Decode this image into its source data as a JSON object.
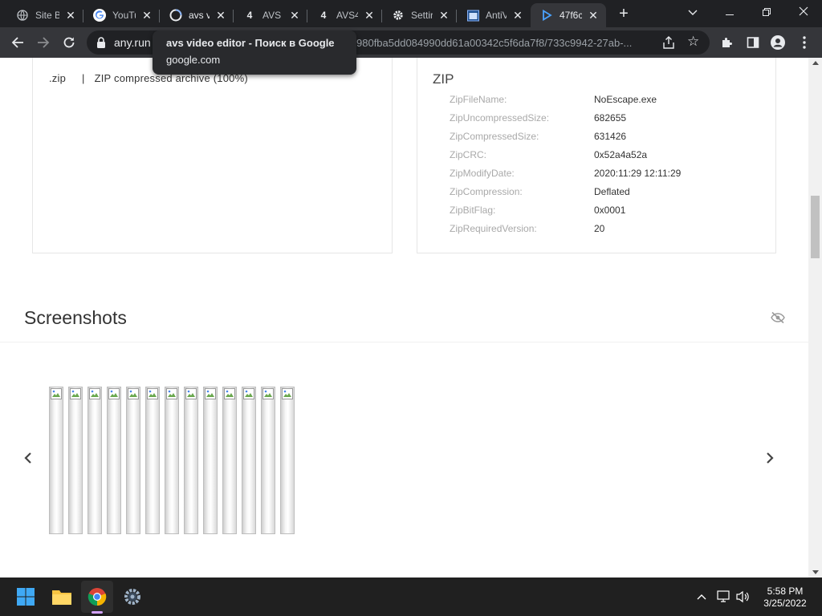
{
  "browser": {
    "tabs": [
      {
        "title": "Site B",
        "icon": "globe-icon"
      },
      {
        "title": "YouTu",
        "icon": "google-g-icon"
      },
      {
        "title": "avs vi",
        "icon": "loading-icon"
      },
      {
        "title": "AVS V",
        "icon": "number-4-icon",
        "badge": "4"
      },
      {
        "title": "AVS4",
        "icon": "number-4-icon",
        "badge": "4"
      },
      {
        "title": "Settir",
        "icon": "gear-icon"
      },
      {
        "title": "AntiV",
        "icon": "window-icon"
      },
      {
        "title": "47f6c",
        "icon": "anyrun-play-icon"
      }
    ],
    "active_tab_index": 7,
    "address": {
      "host": "any.run",
      "path": "980fba5dd084990dd61a00342c5f6da7f8/733c9942-27ab-..."
    },
    "tooltip": {
      "title": "avs video editor - Поиск в Google",
      "url": "google.com"
    }
  },
  "page": {
    "filetype": {
      "ext": ".zip",
      "separator": "|",
      "description": "ZIP compressed archive (100%)"
    },
    "zip": {
      "title": "ZIP",
      "rows": [
        {
          "key": "ZipFileName:",
          "value": "NoEscape.exe"
        },
        {
          "key": "ZipUncompressedSize:",
          "value": "682655"
        },
        {
          "key": "ZipCompressedSize:",
          "value": "631426"
        },
        {
          "key": "ZipCRC:",
          "value": "0x52a4a52a"
        },
        {
          "key": "ZipModifyDate:",
          "value": "2020:11:29 12:11:29"
        },
        {
          "key": "ZipCompression:",
          "value": "Deflated"
        },
        {
          "key": "ZipBitFlag:",
          "value": "0x0001"
        },
        {
          "key": "ZipRequiredVersion:",
          "value": "20"
        }
      ]
    },
    "screenshots": {
      "title": "Screenshots",
      "thumbnail_count": 13
    }
  },
  "taskbar": {
    "apps": [
      "windows-start-icon",
      "file-explorer-icon",
      "chrome-icon",
      "settings-gear-icon"
    ],
    "clock": {
      "time": "5:58 PM",
      "date": "3/25/2022"
    }
  }
}
